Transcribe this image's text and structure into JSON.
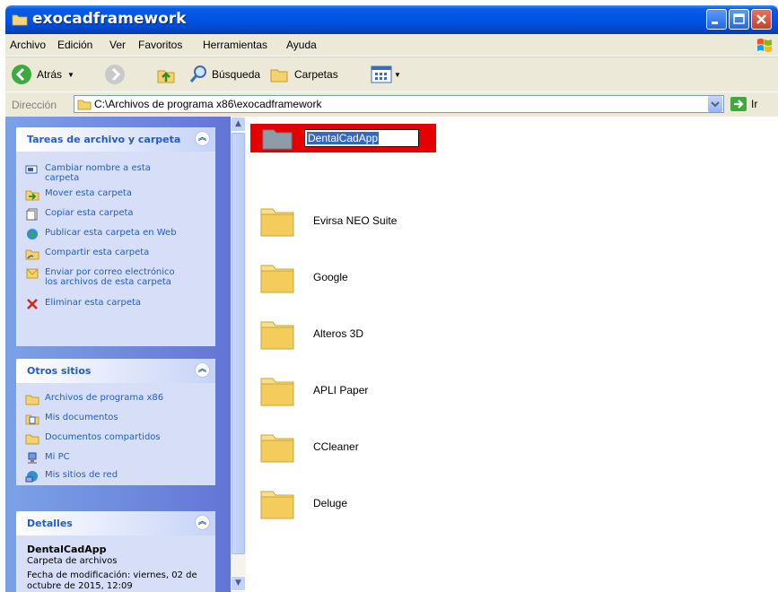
{
  "window": {
    "title": "exocadframework"
  },
  "menu": [
    "Archivo",
    "Edición",
    "Ver",
    "Favoritos",
    "Herramientas",
    "Ayuda"
  ],
  "toolbar": {
    "back_label": "Atrás",
    "search_label": "Búsqueda",
    "folders_label": "Carpetas"
  },
  "address": {
    "label": "Dirección",
    "path": "C:\\Archivos de programa x86\\exocadframework",
    "go_label": "Ir"
  },
  "tasks": {
    "title": "Tareas de archivo y carpeta",
    "items": [
      "Cambiar nombre a esta carpeta",
      "Mover esta carpeta",
      "Copiar esta carpeta",
      "Publicar esta carpeta en Web",
      "Compartir esta carpeta",
      "Enviar por correo electrónico los archivos de esta carpeta",
      "Eliminar esta carpeta"
    ]
  },
  "other_places": {
    "title": "Otros sitios",
    "items": [
      "Archivos de programa x86",
      "Mis documentos",
      "Documentos compartidos",
      "Mi PC",
      "Mis sitios de red"
    ]
  },
  "details": {
    "title": "Detalles",
    "name": "DentalCadApp",
    "type": "Carpeta de archivos",
    "modified": "Fecha de modificación: viernes, 02 de octubre de 2015, 12:09"
  },
  "files": [
    {
      "name": "DentalCadApp",
      "renaming": true
    },
    {
      "name": "Evirsa NEO Suite"
    },
    {
      "name": "Google"
    },
    {
      "name": "Alteros 3D"
    },
    {
      "name": "APLI Paper"
    },
    {
      "name": "CCleaner"
    },
    {
      "name": "Deluge"
    }
  ],
  "colors": {
    "title_blue": "#0054E3",
    "link_blue": "#215DC6",
    "highlight_red": "#E50000",
    "selection": "#316AC5"
  }
}
